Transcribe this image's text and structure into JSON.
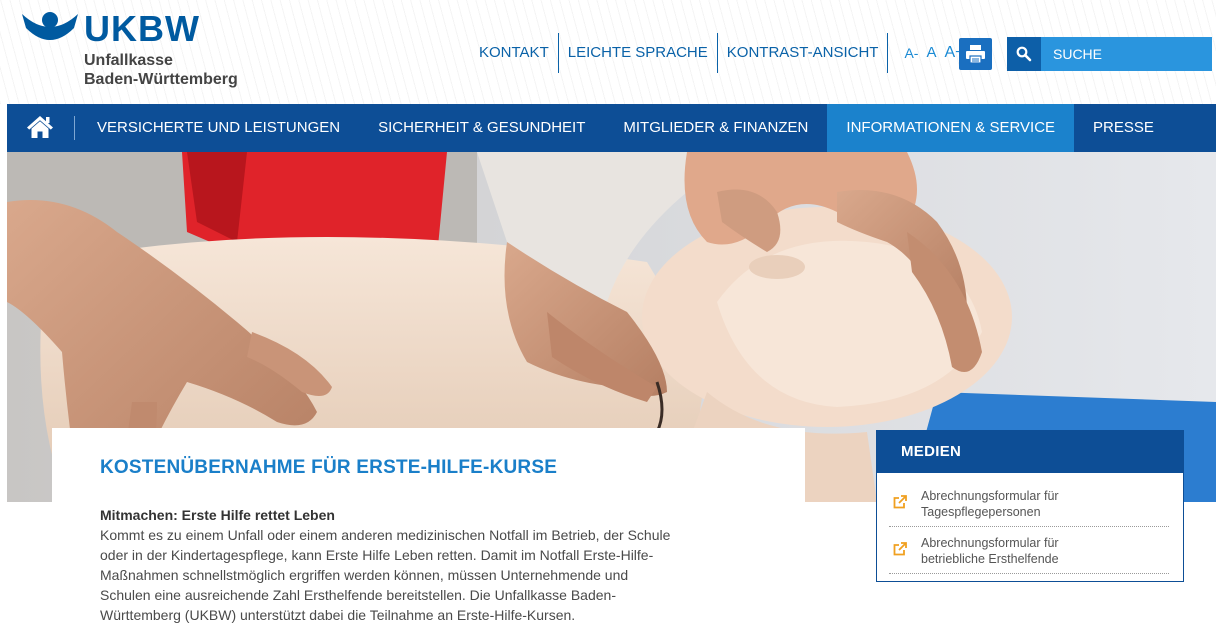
{
  "brand": {
    "abbr": "UKBW",
    "name_line1": "Unfallkasse",
    "name_line2": "Baden-Württemberg",
    "color": "#005aa0"
  },
  "top_links": {
    "kontakt": "KONTAKT",
    "leichte_sprache": "LEICHTE SPRACHE",
    "kontrast": "KONTRAST-ANSICHT",
    "font_small": "A-",
    "font_medium": "A",
    "font_large": "A+"
  },
  "search": {
    "placeholder": "SUCHE"
  },
  "nav": {
    "items": [
      {
        "label": "VERSICHERTE UND LEISTUNGEN"
      },
      {
        "label": "SICHERHEIT & GESUNDHEIT"
      },
      {
        "label": "MITGLIEDER & FINANZEN"
      },
      {
        "label": "INFORMATIONEN & SERVICE",
        "active": true
      },
      {
        "label": "PRESSE"
      }
    ]
  },
  "article": {
    "title": "KOSTENÜBERNAHME FÜR ERSTE-HILFE-KURSE",
    "subtitle": "Mitmachen: Erste Hilfe rettet Leben",
    "body_lines": [
      "Kommt es zu einem Unfall oder einem anderen medizinischen Notfall im Betrieb, der Schule",
      "oder in der Kindertagespflege, kann Erste Hilfe Leben retten. Damit im Notfall Erste-Hilfe-",
      "Maßnahmen schnellstmöglich ergriffen werden können, müssen Unternehmende und",
      "Schulen eine ausreichende Zahl Ersthelfende bereitstellen. Die Unfallkasse Baden-",
      "Württemberg (UKBW) unterstützt dabei die Teilnahme an Erste-Hilfe-Kursen."
    ]
  },
  "media": {
    "title": "MEDIEN",
    "items": [
      {
        "label": "Abrechnungsformular für Tagespflegepersonen"
      },
      {
        "label": "Abrechnungsformular für betriebliche Ersthelfende"
      }
    ]
  },
  "colors": {
    "nav_bg": "#0d4e96",
    "nav_active": "#1b82cc",
    "link_blue": "#0a62a8",
    "search_bg": "#2a95de",
    "title_blue": "#1a7fc9",
    "external_link_icon": "#f0a020"
  },
  "icons": {
    "home": "home-icon",
    "print": "printer-icon",
    "search": "search-icon",
    "external": "external-link-icon"
  }
}
